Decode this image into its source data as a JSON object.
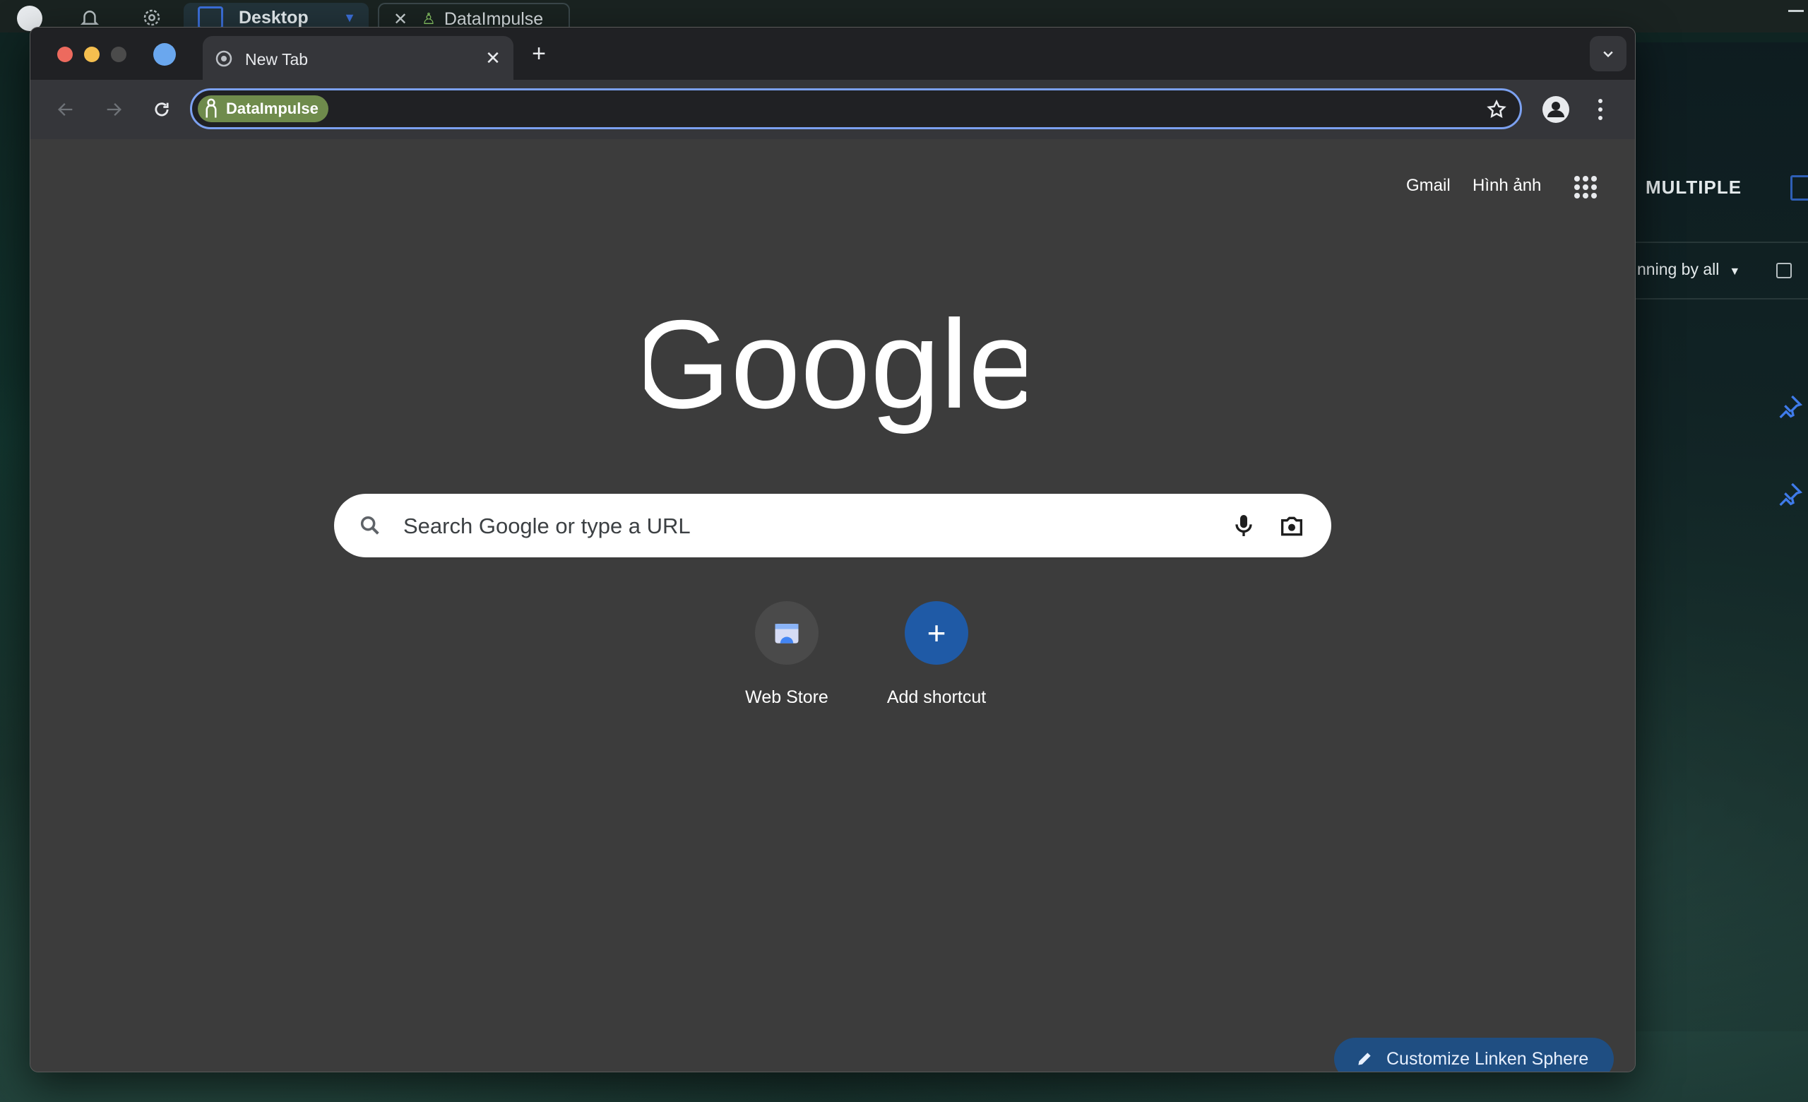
{
  "host": {
    "tabs": [
      {
        "label": "Desktop"
      },
      {
        "label": "DataImpulse"
      }
    ],
    "panel": {
      "multiple_label": "MULTIPLE",
      "sort_label": "nning by all"
    }
  },
  "browser": {
    "tab": {
      "title": "New Tab",
      "close": "✕"
    },
    "new_tab": "+",
    "omnibox": {
      "proxy_label": "DataImpulse",
      "value": ""
    }
  },
  "ntp": {
    "links": {
      "gmail": "Gmail",
      "images": "Hình ảnh"
    },
    "logo": "Google",
    "search": {
      "placeholder": "Search Google or type a URL"
    },
    "shortcuts": [
      {
        "label": "Web Store"
      },
      {
        "label": "Add shortcut",
        "glyph": "+"
      }
    ],
    "customize_label": "Customize Linken Sphere"
  },
  "colors": {
    "accent": "#7ca1f0",
    "proxy_chip": "#6f8b4c",
    "customize_bg": "#1f4e82",
    "ntp_bg": "#3c3c3c"
  }
}
